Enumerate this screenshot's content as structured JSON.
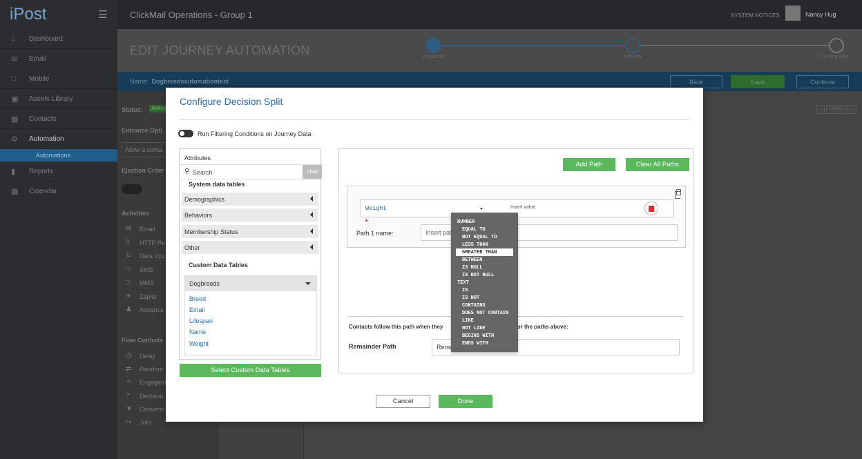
{
  "app": {
    "logo": "iPost",
    "window_title": "ClickMail Operations - Group 1",
    "system_notices": "SYSTEM NOTICES",
    "user_name": "Nancy Hug"
  },
  "sidebar": {
    "items": [
      {
        "label": "Dashboard",
        "icon": "home-icon"
      },
      {
        "label": "Email",
        "icon": "email-icon"
      },
      {
        "label": "Mobile",
        "icon": "mobile-icon"
      },
      {
        "label": "Assets Library",
        "icon": "assets-icon"
      },
      {
        "label": "Contacts",
        "icon": "contacts-icon"
      },
      {
        "label": "Automation",
        "icon": "gear-icon"
      },
      {
        "label": "Reports",
        "icon": "reports-icon"
      },
      {
        "label": "Calendar",
        "icon": "calendar-icon"
      }
    ],
    "sub_item": "Automations"
  },
  "header": {
    "page_title": "EDIT JOURNEY AUTOMATION",
    "steps": [
      "Properties",
      "Activities",
      "Tracking View"
    ]
  },
  "namebar": {
    "name_label": "Name:",
    "name_value": "Dogbreedsautomationtest",
    "back": "Back",
    "save": "Save",
    "continue": "Continue"
  },
  "leftpanel": {
    "status_label": "Status:",
    "status_badge": "Active",
    "entrance": "Entrance Opti",
    "allow": "Allow a conta",
    "ejection": "Ejection Criter",
    "activities_title": "Activities",
    "activities": [
      "Email",
      "HTTP Re",
      "Data Upc",
      "SMS",
      "MMS",
      "Zapier",
      "Advance"
    ],
    "flow_title": "Flow Controls",
    "flow": [
      "Delay",
      "Random",
      "Engagem",
      "Decision",
      "Conversi",
      "Join"
    ]
  },
  "zoom": {
    "minus": "-",
    "level": "100%",
    "plus": "+"
  },
  "modal": {
    "title": "Configure Decision Split",
    "toggle_label": "Run Filtering Conditions on Journey Data",
    "attributes": {
      "heading": "Attributes",
      "search_placeholder": "Search",
      "clear": "Clear",
      "system_title": "System data tables",
      "system_tables": [
        "Demographics",
        "Behaviors",
        "Membership Status",
        "Other"
      ],
      "custom_title": "Custom Data Tables",
      "custom_selected": "Dogbreeds",
      "custom_fields": [
        "Breed",
        "Email",
        "Lifespan",
        "Name",
        "Weight"
      ],
      "select_button": "Select Custom Data Tables"
    },
    "rules": {
      "add_path": "Add Path",
      "clear_all": "Clear All Paths",
      "condition_field": "Weight",
      "condition_value_placeholder": "Insert value",
      "path_name_label": "Path 1 name:",
      "path_name_placeholder": "Insert pat",
      "contacts_text": "Contacts follow this path when they",
      "contacts_text_end": "s for the paths above:",
      "remainder_label": "Remainder Path",
      "remainder_value": "Rema"
    },
    "operators": [
      {
        "label": "NUMBER",
        "group": true
      },
      {
        "label": "EQUAL TO"
      },
      {
        "label": "NOT EQUAL TO"
      },
      {
        "label": "LESS THAN"
      },
      {
        "label": "GREATER THAN",
        "selected": true
      },
      {
        "label": "BETWEEN"
      },
      {
        "label": "IS NULL"
      },
      {
        "label": "IS NOT NULL"
      },
      {
        "label": "TEXT",
        "group": true
      },
      {
        "label": "IS"
      },
      {
        "label": "IS NOT"
      },
      {
        "label": "CONTAINS"
      },
      {
        "label": "DOES NOT CONTAIN"
      },
      {
        "label": "LIKE"
      },
      {
        "label": "NOT LIKE"
      },
      {
        "label": "BEGINS WITH"
      },
      {
        "label": "ENDS WITH"
      }
    ],
    "cancel": "Cancel",
    "done": "Done"
  },
  "colors": {
    "accent_blue": "#2a6da8",
    "green": "#5cb85c",
    "delete_red": "#d9302c",
    "dropdown_bg": "#666666"
  }
}
